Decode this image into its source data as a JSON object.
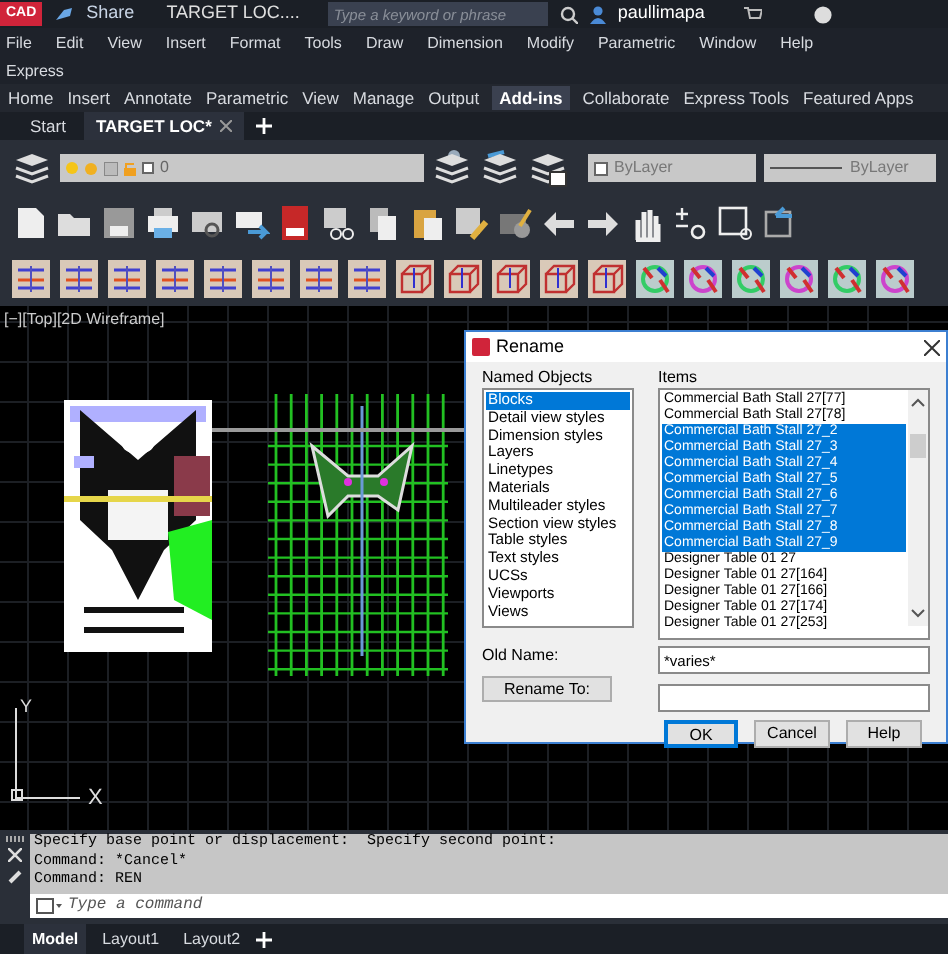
{
  "title_bar": {
    "logo": "CAD",
    "share": "Share",
    "document": "TARGET LOC....",
    "search_placeholder": "Type a keyword or phrase",
    "user": "paullimapa"
  },
  "menu": [
    "File",
    "Edit",
    "View",
    "Insert",
    "Format",
    "Tools",
    "Draw",
    "Dimension",
    "Modify",
    "Parametric",
    "Window",
    "Help",
    "Express"
  ],
  "ribbon_tabs": [
    {
      "label": "Home",
      "selected": false
    },
    {
      "label": "Insert",
      "selected": false
    },
    {
      "label": "Annotate",
      "selected": false
    },
    {
      "label": "Parametric",
      "selected": false
    },
    {
      "label": "View",
      "selected": false
    },
    {
      "label": "Manage",
      "selected": false
    },
    {
      "label": "Output",
      "selected": false
    },
    {
      "label": "Add-ins",
      "selected": true
    },
    {
      "label": "Collaborate",
      "selected": false
    },
    {
      "label": "Express Tools",
      "selected": false
    },
    {
      "label": "Featured Apps",
      "selected": false
    }
  ],
  "doc_tabs": [
    {
      "label": "Start",
      "selected": false
    },
    {
      "label": "TARGET LOC*",
      "selected": true
    }
  ],
  "layer_bar": {
    "layer": "0",
    "color_name": "ByLayer",
    "linetype": "ByLayer"
  },
  "viewport_label": "[−][Top][2D Wireframe]",
  "ucs": {
    "y": "Y",
    "x": "X"
  },
  "rename_dialog": {
    "title": "Rename",
    "named_objects_label": "Named Objects",
    "named_objects": [
      {
        "label": "Blocks",
        "selected": true
      },
      {
        "label": "Detail view styles",
        "selected": false
      },
      {
        "label": "Dimension styles",
        "selected": false
      },
      {
        "label": "Layers",
        "selected": false
      },
      {
        "label": "Linetypes",
        "selected": false
      },
      {
        "label": "Materials",
        "selected": false
      },
      {
        "label": "Multileader styles",
        "selected": false
      },
      {
        "label": "Section view styles",
        "selected": false
      },
      {
        "label": "Table styles",
        "selected": false
      },
      {
        "label": "Text styles",
        "selected": false
      },
      {
        "label": "UCSs",
        "selected": false
      },
      {
        "label": "Viewports",
        "selected": false
      },
      {
        "label": "Views",
        "selected": false
      }
    ],
    "items_label": "Items",
    "items": [
      {
        "label": "Commercial Bath Stall 27[77]",
        "selected": false
      },
      {
        "label": "Commercial Bath Stall 27[78]",
        "selected": false
      },
      {
        "label": "Commercial Bath Stall 27_2",
        "selected": true
      },
      {
        "label": "Commercial Bath Stall 27_3",
        "selected": true
      },
      {
        "label": "Commercial Bath Stall 27_4",
        "selected": true
      },
      {
        "label": "Commercial Bath Stall 27_5",
        "selected": true
      },
      {
        "label": "Commercial Bath Stall 27_6",
        "selected": true
      },
      {
        "label": "Commercial Bath Stall 27_7",
        "selected": true
      },
      {
        "label": "Commercial Bath Stall 27_8",
        "selected": true
      },
      {
        "label": "Commercial Bath Stall 27_9",
        "selected": true
      },
      {
        "label": "Designer Table 01 27",
        "selected": false
      },
      {
        "label": "Designer Table 01 27[164]",
        "selected": false
      },
      {
        "label": "Designer Table 01 27[166]",
        "selected": false
      },
      {
        "label": "Designer Table 01 27[174]",
        "selected": false
      },
      {
        "label": "Designer Table 01 27[253]",
        "selected": false
      }
    ],
    "old_name_label": "Old Name:",
    "old_name": "*varies*",
    "rename_button": "Rename To:",
    "buttons": [
      "OK",
      "Cancel",
      "Help"
    ]
  },
  "command_history": [
    "Specify base point or displacement:  Specify second point:",
    "Command: *Cancel*",
    "Command: REN"
  ],
  "command_placeholder": "Type a command",
  "layout_tabs": [
    {
      "label": "Model",
      "selected": true
    },
    {
      "label": "Layout1",
      "selected": false
    },
    {
      "label": "Layout2",
      "selected": false
    }
  ]
}
